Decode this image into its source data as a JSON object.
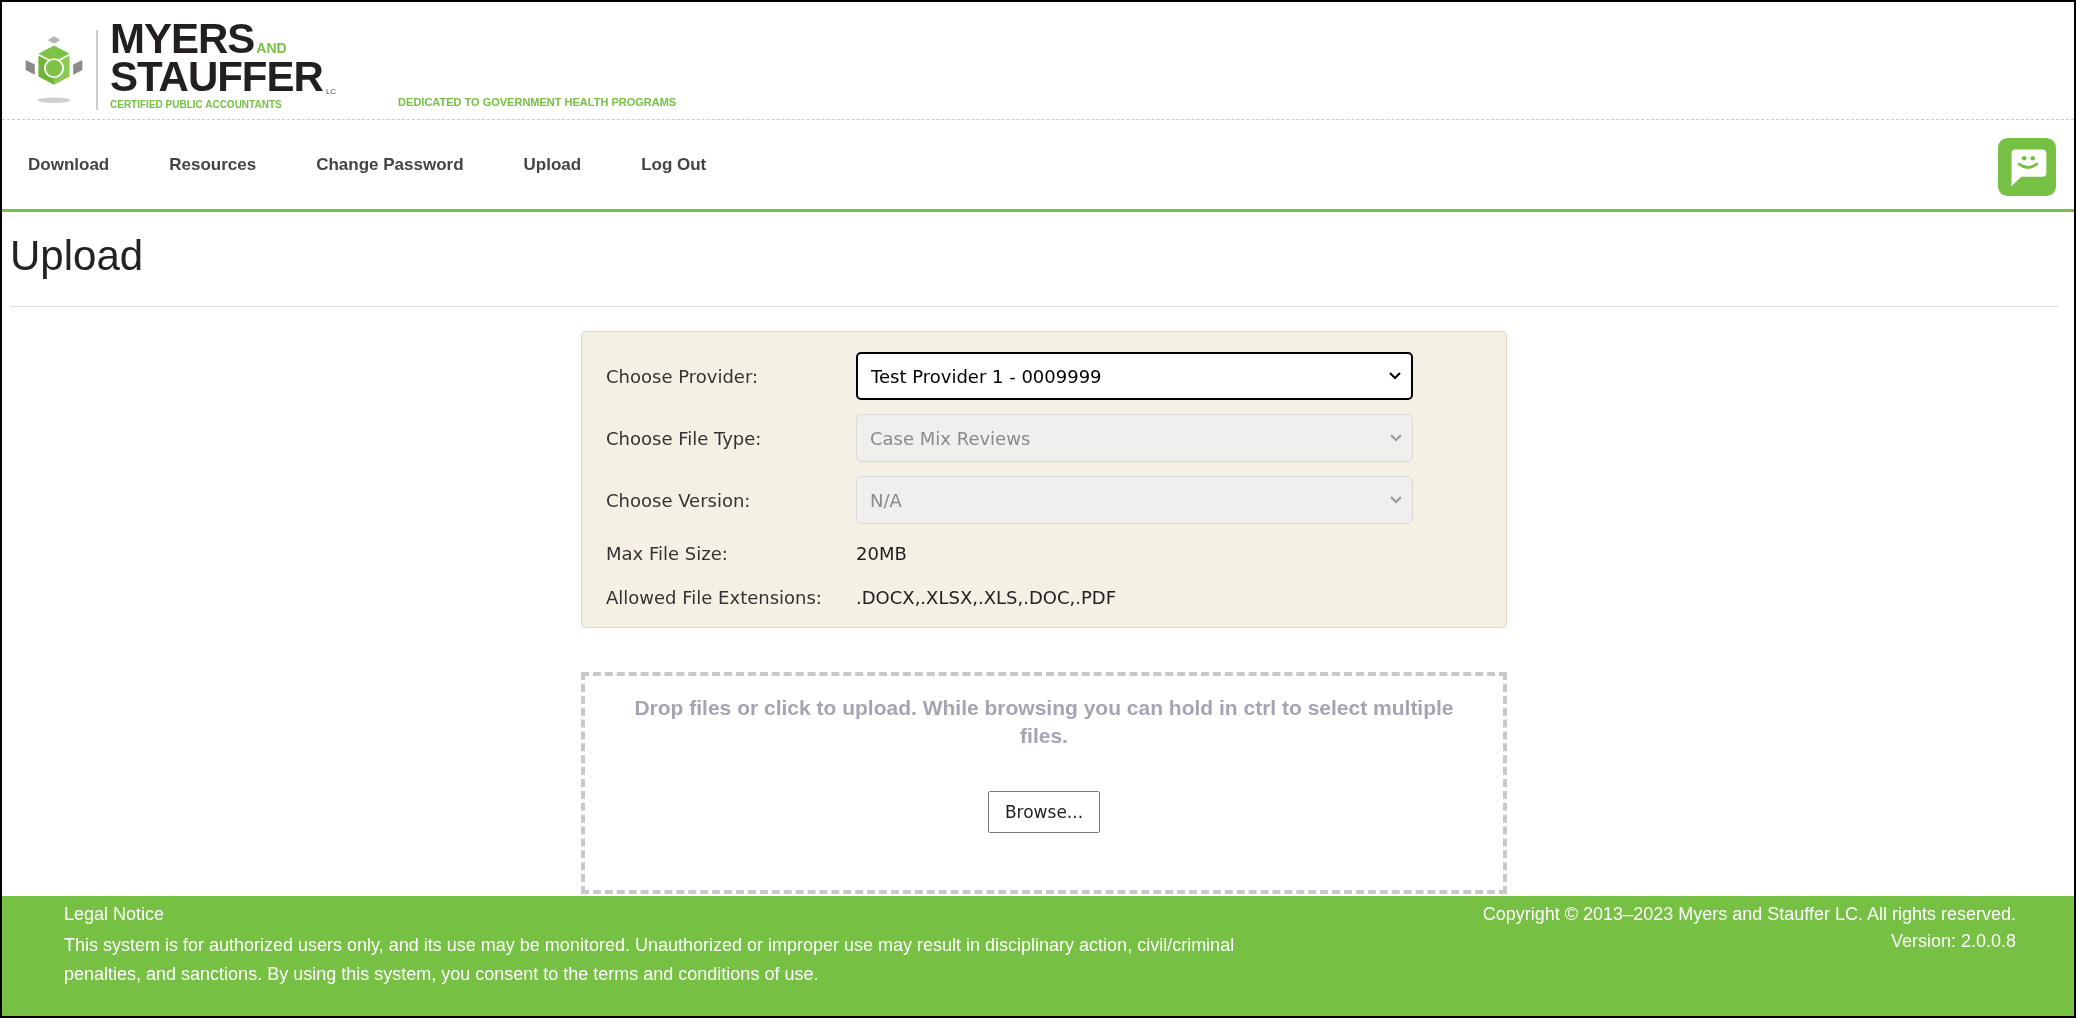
{
  "logo": {
    "name_top": "MYERS",
    "name_and": "AND",
    "name_bottom": "STAUFFER",
    "suffix": "LC",
    "subtitle": "CERTIFIED PUBLIC ACCOUNTANTS"
  },
  "tagline": "DEDICATED TO GOVERNMENT HEALTH PROGRAMS",
  "nav": [
    {
      "label": "Download"
    },
    {
      "label": "Resources"
    },
    {
      "label": "Change Password"
    },
    {
      "label": "Upload"
    },
    {
      "label": "Log Out"
    }
  ],
  "page_title": "Upload",
  "form": {
    "fields": [
      {
        "kind": "select",
        "label": "Choose Provider:",
        "value": "Test Provider 1 - 0009999",
        "disabled": false
      },
      {
        "kind": "select",
        "label": "Choose File Type:",
        "value": "Case Mix Reviews",
        "disabled": true
      },
      {
        "kind": "select",
        "label": "Choose Version:",
        "value": "N/A",
        "disabled": true
      },
      {
        "kind": "info",
        "label": "Max File Size:",
        "value": "20MB"
      },
      {
        "kind": "info",
        "label": "Allowed File Extensions:",
        "value": ".DOCX,.XLSX,.XLS,.DOC,.PDF"
      }
    ]
  },
  "dropzone": {
    "hint": "Drop files or click to upload. While browsing you can hold in ctrl to select multiple files.",
    "button": "Browse..."
  },
  "footer": {
    "title": "Legal Notice",
    "notice": "This system is for authorized users only, and its use may be monitored. Unauthorized or improper use may result in disciplinary action, civil/criminal penalties, and sanctions. By using this system, you consent to the terms and conditions of use.",
    "copyright": "Copyright © 2013–2023 Myers and Stauffer LC. All rights reserved.",
    "version": "Version: 2.0.0.8"
  }
}
